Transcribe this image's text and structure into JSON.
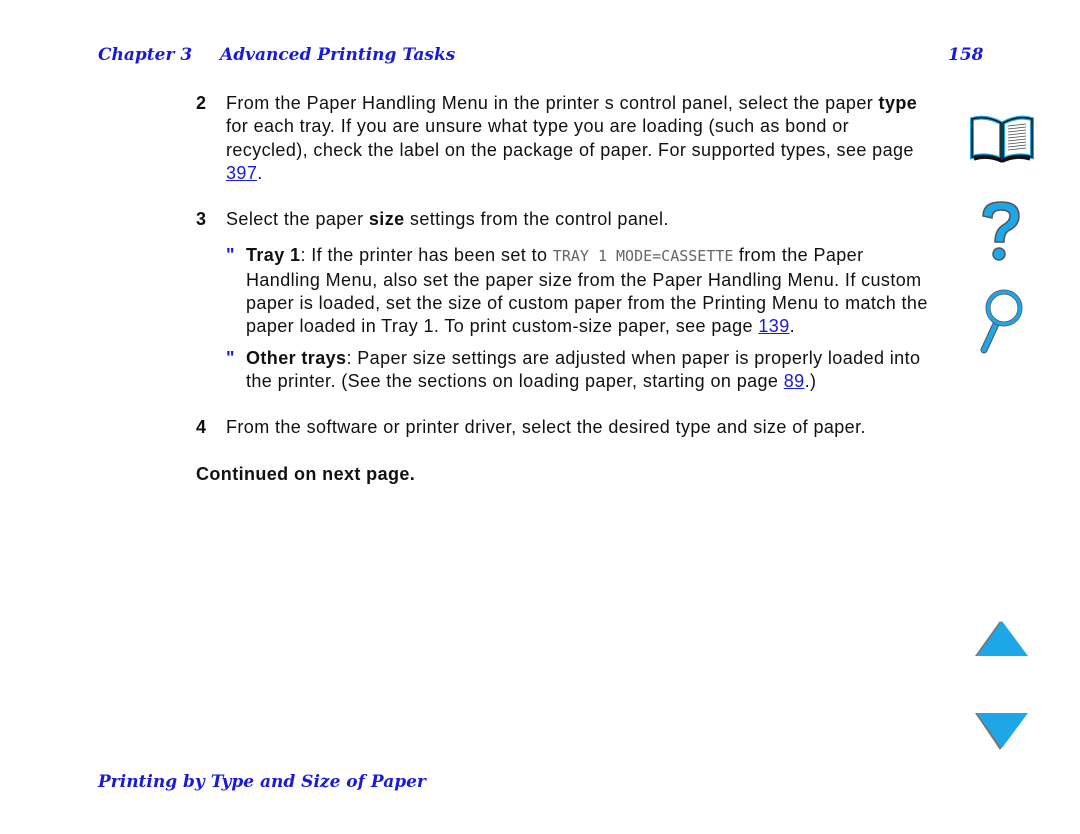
{
  "header": {
    "chapter": "Chapter 3",
    "title": "Advanced Printing Tasks",
    "page_number": "158"
  },
  "steps": [
    {
      "num": "2",
      "parts": [
        "From the Paper Handling Menu in the printer s control panel, select the paper ",
        "type",
        " for each tray. If you are unsure what type you are loading (such as bond or recycled), check the label on the package of paper. For supported types, see page ",
        "397",
        "."
      ]
    },
    {
      "num": "3",
      "parts": [
        "Select the paper ",
        "size",
        " settings from the control panel."
      ]
    },
    {
      "num": "4",
      "parts": [
        "From the software or printer driver, select the desired type and size of paper."
      ]
    }
  ],
  "bullets": [
    {
      "mark": "\"",
      "label": "Tray 1",
      "pre": ": If the printer has been set to ",
      "code": "TRAY 1 MODE=CASSETTE",
      "post": " from the Paper Handling Menu, also set the paper size from the Paper Handling Menu. If custom paper is loaded, set the size of custom paper from the Printing Menu to match the paper loaded in Tray 1. To print custom-size paper, see page ",
      "link": "139",
      "end": "."
    },
    {
      "mark": "\"",
      "label": "Other trays",
      "pre": ": Paper size settings are adjusted when paper is properly loaded into the printer. (See the sections on loading paper, starting on page ",
      "link": "89",
      "end": ".)"
    }
  ],
  "continued": "Continued on next page.",
  "footer": "Printing by Type and Size of Paper",
  "nav": {
    "contents": "book-icon",
    "help": "question-icon",
    "search": "magnifier-icon",
    "prev": "up-arrow-icon",
    "next": "down-arrow-icon"
  },
  "colors": {
    "link": "#1a1adc",
    "icon": "#1ea7e8"
  }
}
